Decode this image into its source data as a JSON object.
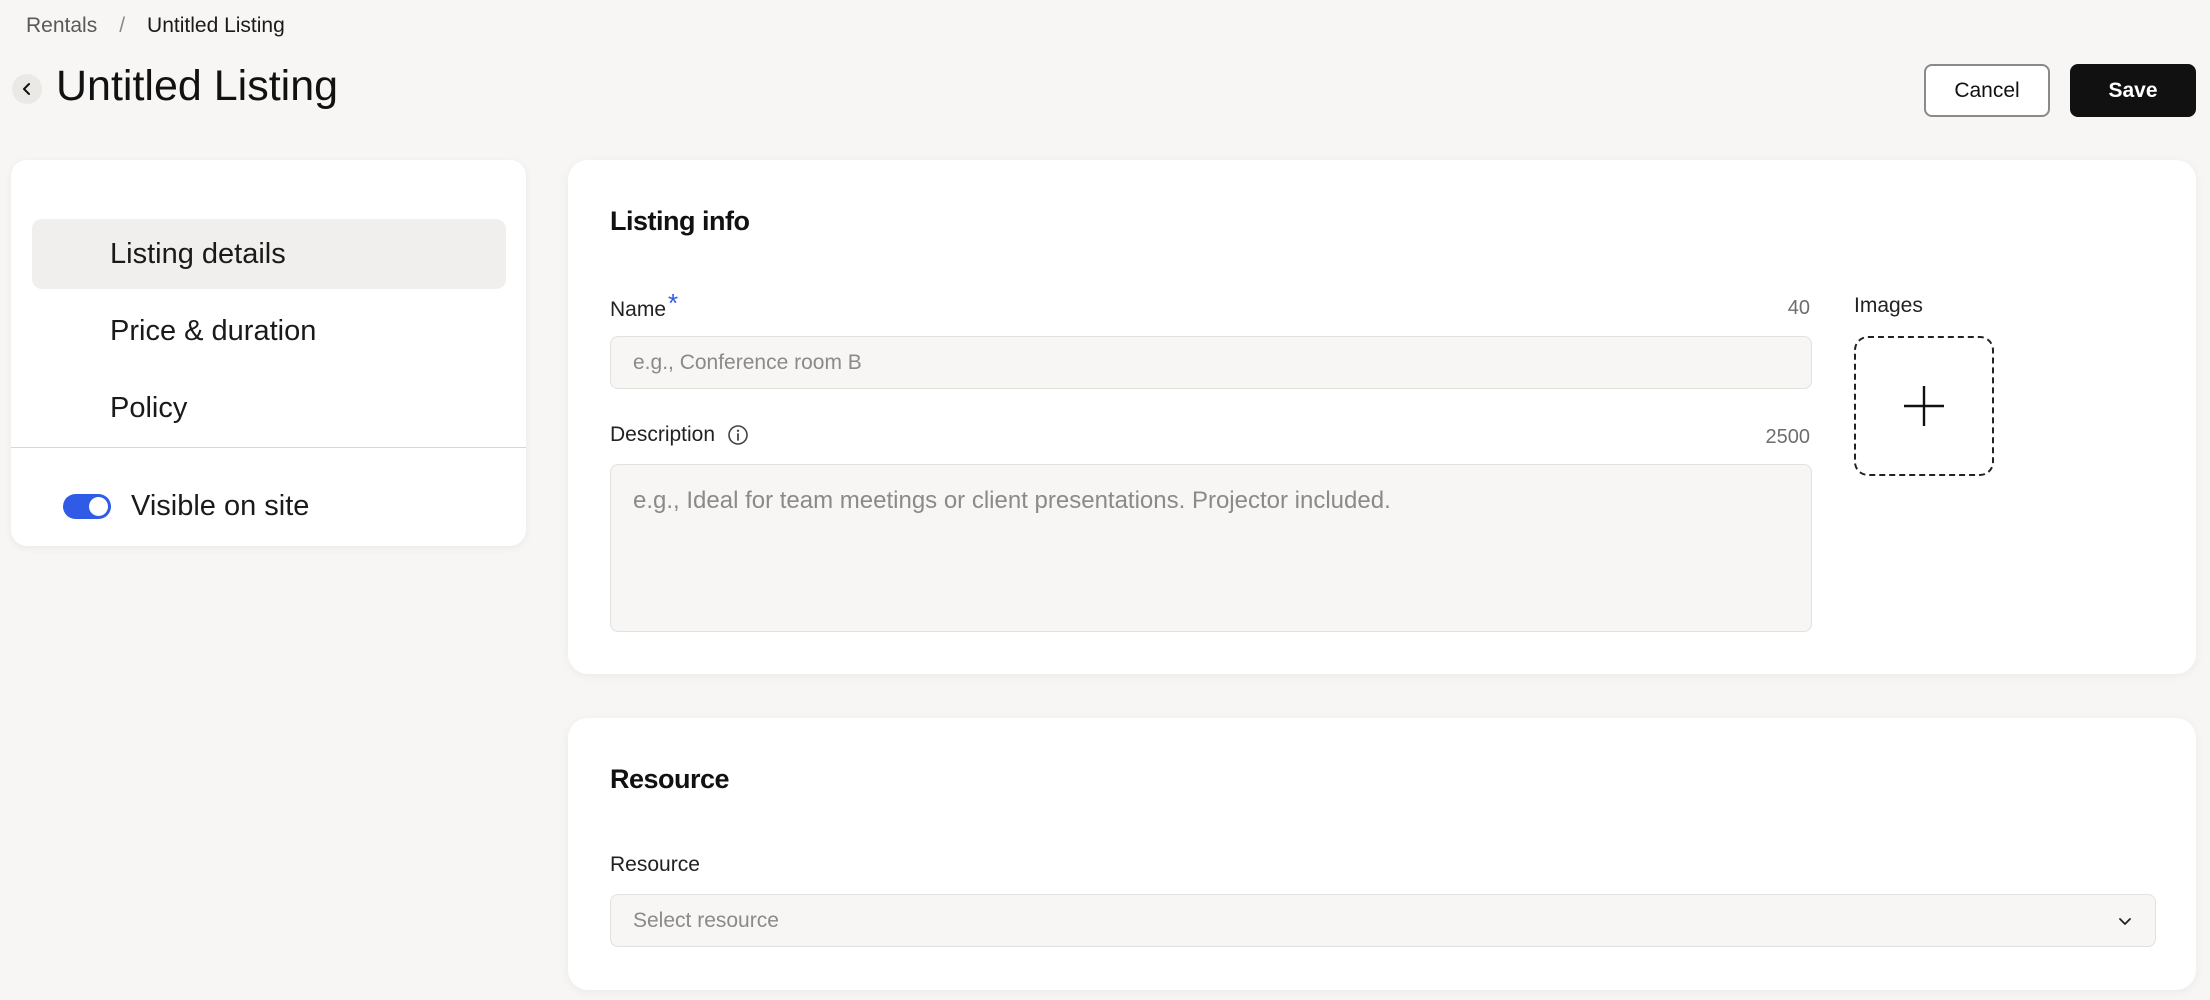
{
  "breadcrumb": {
    "parent": "Rentals",
    "separator": "/",
    "current": "Untitled Listing"
  },
  "header": {
    "title": "Untitled Listing",
    "cancel_label": "Cancel",
    "save_label": "Save"
  },
  "sidebar": {
    "items": [
      {
        "label": "Listing details",
        "active": true
      },
      {
        "label": "Price & duration",
        "active": false
      },
      {
        "label": "Policy",
        "active": false
      }
    ],
    "visibility": {
      "label": "Visible on site",
      "enabled": true
    }
  },
  "listing_info": {
    "title": "Listing info",
    "name": {
      "label": "Name",
      "required_mark": "*",
      "char_limit": "40",
      "placeholder": "e.g., Conference room B",
      "value": ""
    },
    "description": {
      "label": "Description",
      "char_limit": "2500",
      "placeholder": "e.g., Ideal for team meetings or client presentations. Projector included.",
      "value": ""
    },
    "images": {
      "label": "Images"
    }
  },
  "resource": {
    "title": "Resource",
    "field_label": "Resource",
    "placeholder": "Select resource"
  },
  "colors": {
    "accent": "#2f5be6",
    "background": "#f7f6f4",
    "primary_button": "#111111"
  }
}
